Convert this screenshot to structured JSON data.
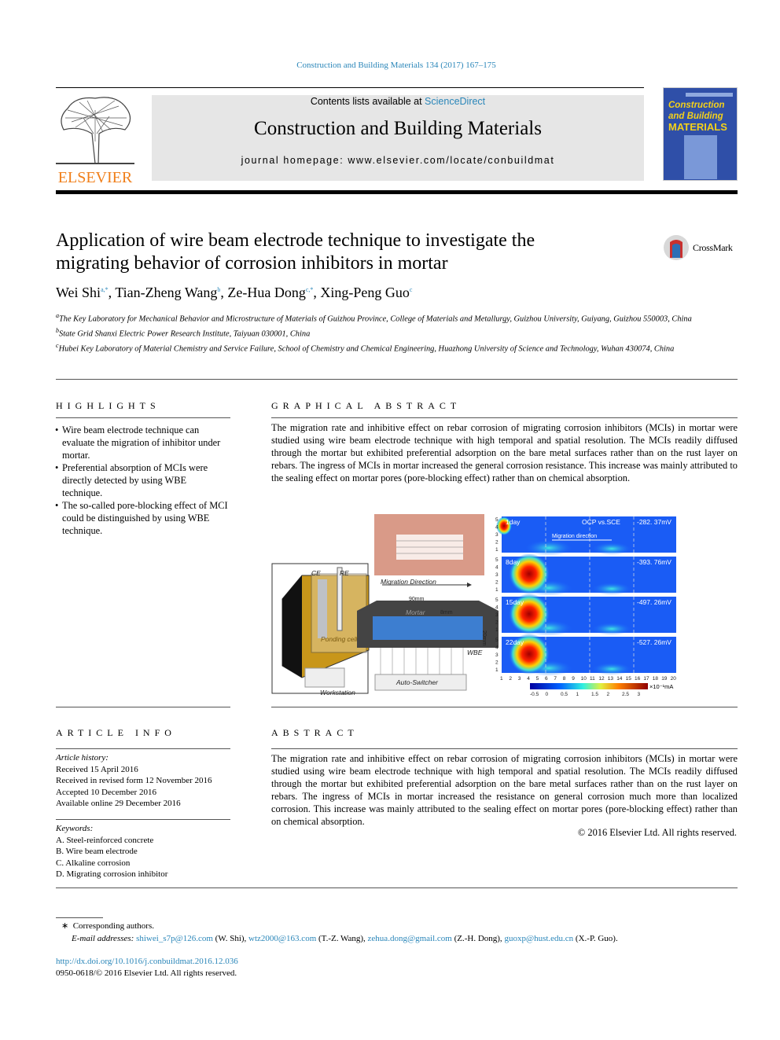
{
  "journal_ref": "Construction and Building Materials 134 (2017) 167–175",
  "header": {
    "publisher_logo_text": "ELSEVIER",
    "contents_prefix": "Contents lists available at ",
    "contents_link": "ScienceDirect",
    "journal_title": "Construction and Building Materials",
    "homepage": "journal homepage: www.elsevier.com/locate/conbuildmat",
    "cover_title": [
      "Construction",
      "and Building",
      "MATERIALS"
    ]
  },
  "article": {
    "title_line1": "Application of wire beam electrode technique to investigate the",
    "title_line2": "migrating behavior of corrosion inhibitors in mortar",
    "crossmark": "CrossMark",
    "authors": [
      {
        "name": "Wei Shi",
        "sup": "a,*",
        "sep": ", "
      },
      {
        "name": "Tian-Zheng Wang",
        "sup": "b",
        "sep": ", "
      },
      {
        "name": "Ze-Hua Dong",
        "sup": "c,*",
        "sep": ", "
      },
      {
        "name": "Xing-Peng Guo",
        "sup": "c",
        "sep": ""
      }
    ],
    "affiliations": [
      {
        "mark": "a",
        "text": "The Key Laboratory for Mechanical Behavior and Microstructure of Materials of Guizhou Province, College of Materials and Metallurgy, Guizhou University, Guiyang, Guizhou 550003, China"
      },
      {
        "mark": "b",
        "text": "State Grid Shanxi Electric Power Research Institute, Taiyuan 030001, China"
      },
      {
        "mark": "c",
        "text": "Hubei Key Laboratory of Material Chemistry and Service Failure, School of Chemistry and Chemical Engineering, Huazhong University of Science and Technology, Wuhan 430074, China"
      }
    ]
  },
  "highlights": {
    "heading": "HIGHLIGHTS",
    "items": [
      "Wire beam electrode technique can evaluate the migration of inhibitor under mortar.",
      "Preferential absorption of MCIs were directly detected by using WBE technique.",
      "The so-called pore-blocking effect of MCI could be distinguished by using WBE technique."
    ]
  },
  "graphical_abstract": {
    "heading": "GRAPHICAL ABSTRACT",
    "text": "The migration rate and inhibitive effect on rebar corrosion of migrating corrosion inhibitors (MCIs) in mortar were studied using wire beam electrode technique with high temporal and spatial resolution. The MCIs readily diffused through the mortar but exhibited preferential adsorption on the bare metal surfaces rather than on the rust layer on rebars. The ingress of MCIs in mortar increased the general corrosion resistance. This increase was mainly attributed to the sealing effect on mortar pores (pore-blocking effect) rather than on chemical absorption.",
    "figure": {
      "labels": {
        "ce": "CE",
        "re": "RE",
        "migration": "Migration Direction",
        "len": "90mm",
        "mortar": "Mortar",
        "depth": "8mm",
        "height": "20mm",
        "ponding": "Ponding cell",
        "wbe": "WBE",
        "switcher": "Auto-Switcher",
        "workstation": "Workstation",
        "ocp": "OCP vs.SCE",
        "migration2": "Migration direction",
        "unit": "×10⁻¹mA"
      },
      "panels": [
        {
          "day": "1day",
          "potential": "-282. 37mV"
        },
        {
          "day": "8day",
          "potential": "-393. 76mV"
        },
        {
          "day": "15day",
          "potential": "-497. 26mV"
        },
        {
          "day": "22day",
          "potential": "-527. 26mV"
        }
      ],
      "x_ticks": [
        "1",
        "2",
        "3",
        "4",
        "5",
        "6",
        "7",
        "8",
        "9",
        "10",
        "11",
        "12",
        "13",
        "14",
        "15",
        "16",
        "17",
        "18",
        "19",
        "20"
      ],
      "y_ticks": [
        "5",
        "4",
        "3",
        "2",
        "1"
      ],
      "colorbar_ticks": [
        "-0.5",
        "0",
        "0.5",
        "1",
        "1.5",
        "2",
        "2.5",
        "3"
      ]
    }
  },
  "article_info": {
    "heading": "ARTICLE INFO",
    "history_label": "Article history:",
    "history": [
      "Received 15 April 2016",
      "Received in revised form 12 November 2016",
      "Accepted 10 December 2016",
      "Available online 29 December 2016"
    ],
    "keywords_label": "Keywords:",
    "keywords": [
      "A. Steel-reinforced concrete",
      "B. Wire beam electrode",
      "C. Alkaline corrosion",
      "D. Migrating corrosion inhibitor"
    ]
  },
  "abstract": {
    "heading": "ABSTRACT",
    "text": "The migration rate and inhibitive effect on rebar corrosion of migrating corrosion inhibitors (MCIs) in mortar were studied using wire beam electrode technique with high temporal and spatial resolution. The MCIs readily diffused through the mortar but exhibited preferential adsorption on the bare metal surfaces rather than on the rust layer on rebars. The ingress of MCIs in mortar increased the resistance on general corrosion much more than localized corrosion. This increase was mainly attributed to the sealing effect on mortar pores (pore-blocking effect) rather than on chemical absorption.",
    "copyright": "© 2016 Elsevier Ltd. All rights reserved."
  },
  "footer": {
    "corresponding": "Corresponding authors.",
    "email_label": "E-mail addresses:",
    "emails": [
      {
        "email": "shiwei_s7p@126.com",
        "who": " (W. Shi), "
      },
      {
        "email": "wtz2000@163.com",
        "who": " (T.-Z. Wang), "
      },
      {
        "email": "zehua.dong@gmail.com",
        "who": " (Z.-H. Dong), "
      },
      {
        "email": "guoxp@hust.edu.cn",
        "who": " (X.-P. Guo)."
      }
    ],
    "doi": "http://dx.doi.org/10.1016/j.conbuildmat.2016.12.036",
    "issn": "0950-0618/© 2016 Elsevier Ltd. All rights reserved."
  },
  "colors": {
    "link": "#2a86b9",
    "elsevier_orange": "#f07f1a",
    "header_gray": "#e6e6e6",
    "cover_blue": "#2f4fa8"
  }
}
